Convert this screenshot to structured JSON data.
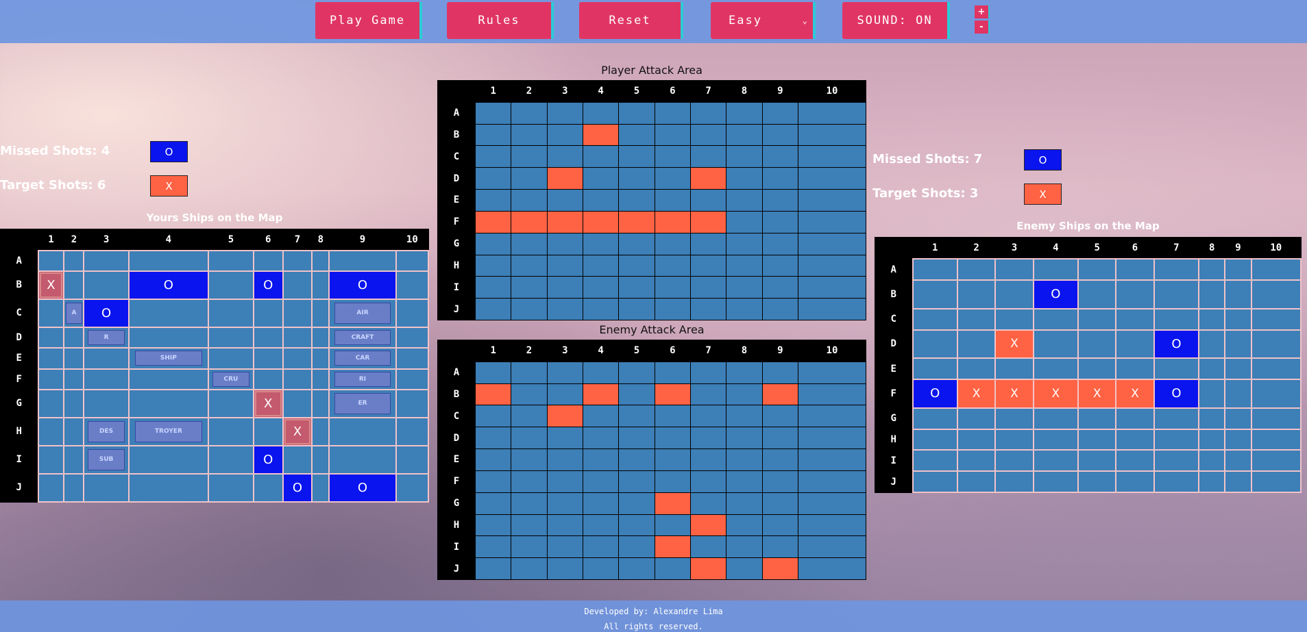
{
  "toolbar": {
    "play_label": "Play Game",
    "rules_label": "Rules",
    "reset_label": "Reset",
    "difficulty_value": "Easy",
    "sound_label": "SOUND: ON",
    "zoom_in": "+",
    "zoom_out": "-"
  },
  "player_stats": {
    "missed": "Missed Shots: 4",
    "target": "Target Shots: 6"
  },
  "enemy_stats": {
    "missed": "Missed Shots: 7",
    "target": "Target Shots: 3"
  },
  "legend": {
    "miss_symbol": "O",
    "hit_symbol": "X"
  },
  "titles": {
    "your_ships": "Yours Ships on the Map",
    "player_attack": "Player Attack Area",
    "enemy_attack": "Enemy Attack Area",
    "enemy_ships": "Enemy Ships on the Map"
  },
  "grid": {
    "cols": [
      "1",
      "2",
      "3",
      "4",
      "5",
      "6",
      "7",
      "8",
      "9",
      "10"
    ],
    "rows": [
      "A",
      "B",
      "C",
      "D",
      "E",
      "F",
      "G",
      "H",
      "I",
      "J"
    ]
  },
  "your_board": {
    "B": {
      "1": "shiphit",
      "4": "miss",
      "6": "miss",
      "9": "miss"
    },
    "C": {
      "2": "ship:A",
      "3": "miss",
      "9": "ship:AIR"
    },
    "D": {
      "3": "ship:R",
      "9": "ship:CRAFT"
    },
    "E": {
      "4": "ship:SHIP",
      "9": "ship:CAR"
    },
    "F": {
      "5": "ship:CRU",
      "9": "ship:RI"
    },
    "G": {
      "6": "shiphit",
      "9": "ship:ER"
    },
    "H": {
      "3": "ship:DES",
      "4": "ship:TROYER",
      "7": "shiphit"
    },
    "I": {
      "3": "ship:SUB",
      "6": "miss"
    },
    "J": {
      "7": "miss",
      "9": "miss"
    }
  },
  "player_attack": {
    "B": {
      "4": "hit"
    },
    "D": {
      "3": "hit",
      "7": "hit"
    },
    "F": {
      "1": "hit",
      "2": "hit",
      "3": "hit",
      "4": "hit",
      "5": "hit",
      "6": "hit",
      "7": "hit"
    }
  },
  "enemy_attack": {
    "B": {
      "1": "hit",
      "4": "hit",
      "6": "hit",
      "9": "hit"
    },
    "C": {
      "3": "hit"
    },
    "G": {
      "6": "hit"
    },
    "H": {
      "7": "hit"
    },
    "I": {
      "6": "hit"
    },
    "J": {
      "7": "hit",
      "9": "hit"
    }
  },
  "enemy_board": {
    "B": {
      "4": "miss"
    },
    "D": {
      "3": "hitx",
      "7": "miss"
    },
    "F": {
      "1": "miss",
      "2": "hitx",
      "3": "hitx",
      "4": "hitx",
      "5": "hitx",
      "6": "hitx",
      "7": "miss"
    }
  },
  "footer": {
    "line1": "Developed by: Alexandre Lima",
    "line2": "All rights reserved."
  },
  "colors": {
    "button": "#e03564",
    "button_edge": "#2ccbd6",
    "cell": "#3d7fb7",
    "miss": "#0a14ee",
    "hit": "#ff6344",
    "header": "#000000"
  }
}
